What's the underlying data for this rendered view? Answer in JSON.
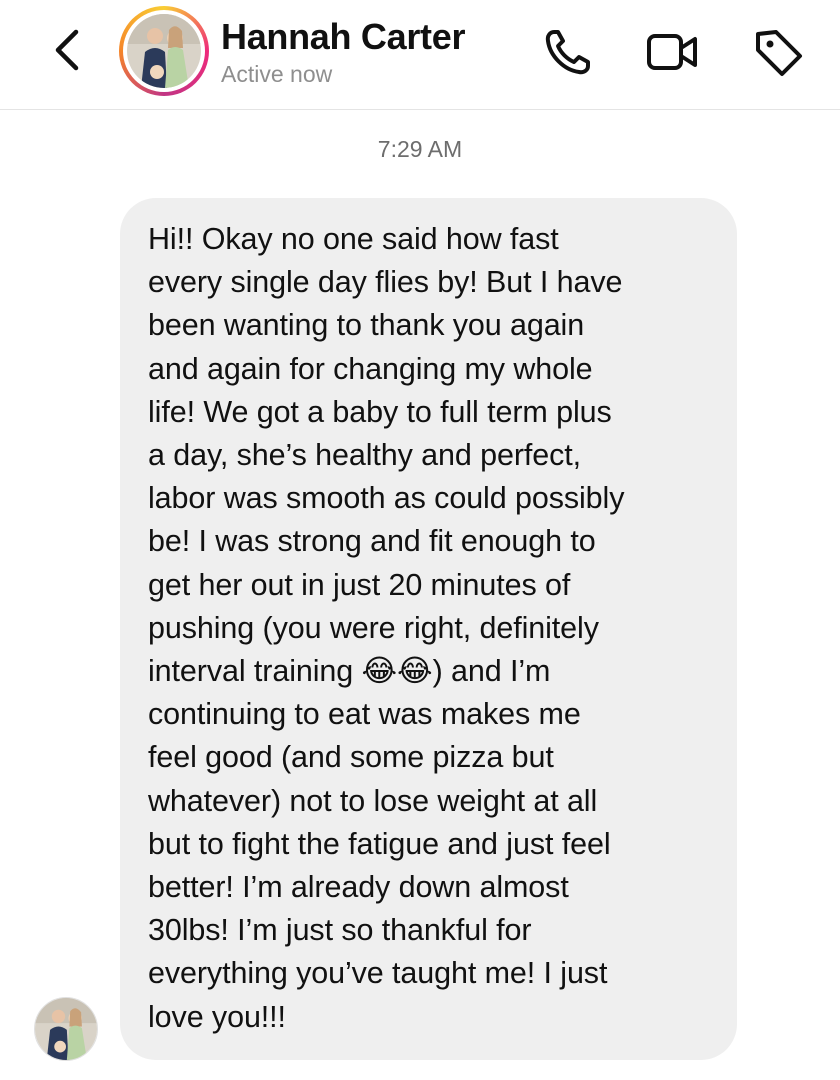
{
  "header": {
    "contact_name": "Hannah Carter",
    "status": "Active now",
    "icons": [
      "chevron-left-icon",
      "phone-icon",
      "video-icon",
      "tag-icon"
    ]
  },
  "thread": {
    "timestamp": "7:29 AM",
    "message": {
      "lines": [
        "Hi!! Okay no one said how fast",
        "every single day flies by! But I have",
        "been wanting to thank you again",
        "and again for changing my whole",
        "life! We got a baby to full term plus",
        "a day, she’s healthy and perfect,",
        "labor was smooth as could possibly",
        "be! I was strong and fit enough to",
        "get her out in just 20 minutes of",
        "pushing (you were right, definitely",
        "interval training 😂😂) and I’m",
        "continuing to eat was makes me",
        "feel good (and some pizza but",
        "whatever) not to lose weight at all",
        "but to fight the fatigue and just feel",
        "better! I’m already down almost",
        "30lbs! I’m just so thankful for",
        "everything you’ve taught me! I just",
        "love you!!!"
      ]
    }
  },
  "colors": {
    "bubble_bg": "#efefef",
    "text": "#111111",
    "muted": "#8e8e8e",
    "ring_gradient": [
      "#f9ce34",
      "#ee2a7b",
      "#c13584"
    ]
  }
}
